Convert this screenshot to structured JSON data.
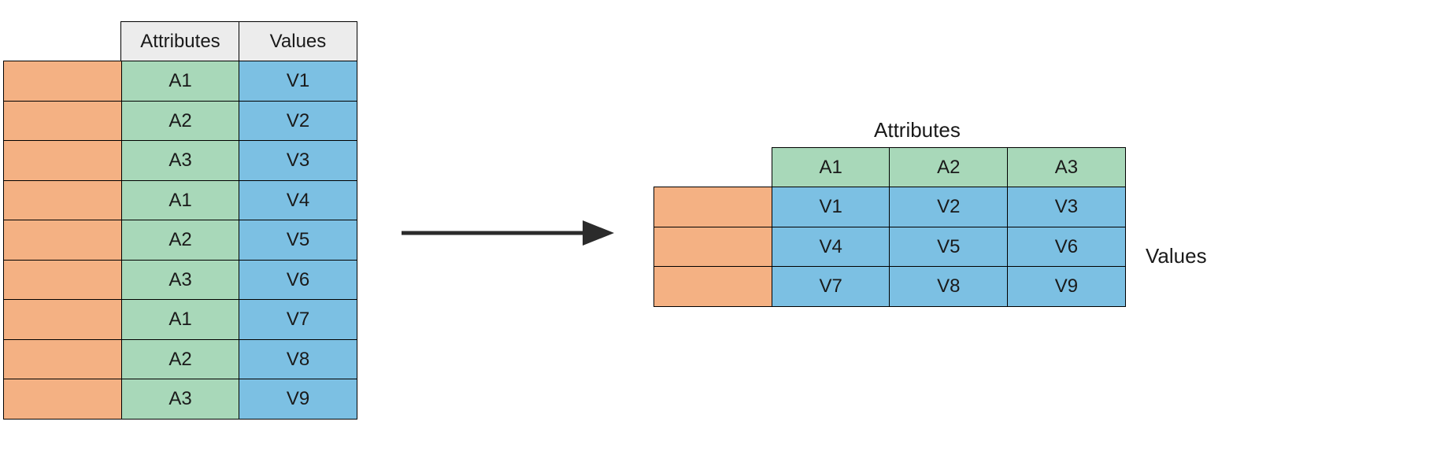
{
  "headers": {
    "attributes": "Attributes",
    "values": "Values"
  },
  "long_table": {
    "rows": [
      {
        "attr": "A1",
        "val": "V1"
      },
      {
        "attr": "A2",
        "val": "V2"
      },
      {
        "attr": "A3",
        "val": "V3"
      },
      {
        "attr": "A1",
        "val": "V4"
      },
      {
        "attr": "A2",
        "val": "V5"
      },
      {
        "attr": "A3",
        "val": "V6"
      },
      {
        "attr": "A1",
        "val": "V7"
      },
      {
        "attr": "A2",
        "val": "V8"
      },
      {
        "attr": "A3",
        "val": "V9"
      }
    ]
  },
  "wide_table": {
    "col_headers": [
      "A1",
      "A2",
      "A3"
    ],
    "rows": [
      [
        "V1",
        "V2",
        "V3"
      ],
      [
        "V4",
        "V5",
        "V6"
      ],
      [
        "V7",
        "V8",
        "V9"
      ]
    ]
  },
  "labels": {
    "right_top": "Attributes",
    "right_side": "Values"
  },
  "colors": {
    "orange": "#f4b183",
    "green": "#a8d8b9",
    "blue": "#7cc0e3",
    "header": "#ececec"
  }
}
